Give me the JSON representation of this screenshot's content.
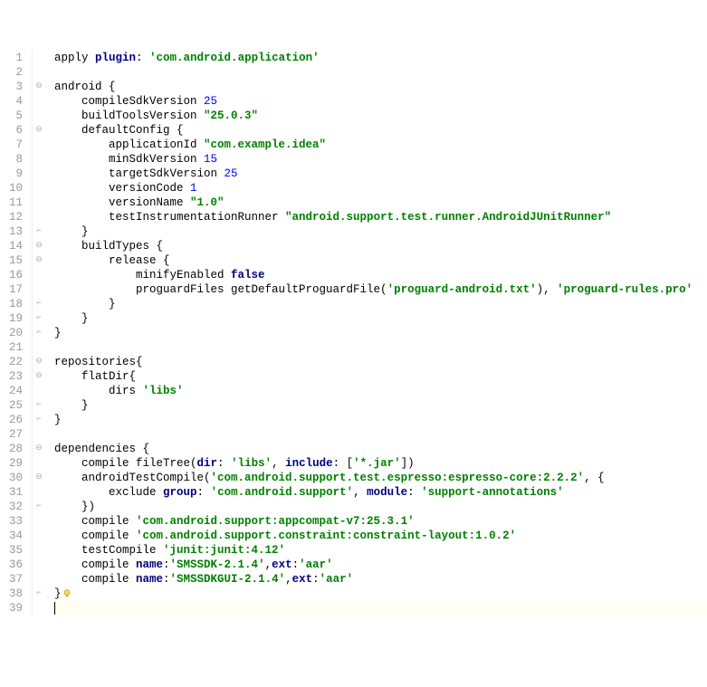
{
  "lines": [
    {
      "n": 1,
      "fold": "",
      "segments": [
        {
          "t": "apply ",
          "c": "plain"
        },
        {
          "t": "plugin",
          "c": "kw"
        },
        {
          "t": ": ",
          "c": "plain"
        },
        {
          "t": "'com.android.application'",
          "c": "str"
        }
      ]
    },
    {
      "n": 2,
      "fold": "",
      "segments": [
        {
          "t": "",
          "c": "plain"
        }
      ]
    },
    {
      "n": 3,
      "fold": "open",
      "segments": [
        {
          "t": "android {",
          "c": "plain"
        }
      ]
    },
    {
      "n": 4,
      "fold": "",
      "segments": [
        {
          "t": "    compileSdkVersion ",
          "c": "plain"
        },
        {
          "t": "25",
          "c": "num"
        }
      ]
    },
    {
      "n": 5,
      "fold": "",
      "segments": [
        {
          "t": "    buildToolsVersion ",
          "c": "plain"
        },
        {
          "t": "\"25.0.3\"",
          "c": "str"
        }
      ]
    },
    {
      "n": 6,
      "fold": "open",
      "segments": [
        {
          "t": "    defaultConfig {",
          "c": "plain"
        }
      ]
    },
    {
      "n": 7,
      "fold": "",
      "segments": [
        {
          "t": "        applicationId ",
          "c": "plain"
        },
        {
          "t": "\"com.example.idea\"",
          "c": "str"
        }
      ]
    },
    {
      "n": 8,
      "fold": "",
      "segments": [
        {
          "t": "        minSdkVersion ",
          "c": "plain"
        },
        {
          "t": "15",
          "c": "num"
        }
      ]
    },
    {
      "n": 9,
      "fold": "",
      "segments": [
        {
          "t": "        targetSdkVersion ",
          "c": "plain"
        },
        {
          "t": "25",
          "c": "num"
        }
      ]
    },
    {
      "n": 10,
      "fold": "",
      "segments": [
        {
          "t": "        versionCode ",
          "c": "plain"
        },
        {
          "t": "1",
          "c": "num"
        }
      ]
    },
    {
      "n": 11,
      "fold": "",
      "segments": [
        {
          "t": "        versionName ",
          "c": "plain"
        },
        {
          "t": "\"1.0\"",
          "c": "str"
        }
      ]
    },
    {
      "n": 12,
      "fold": "",
      "segments": [
        {
          "t": "        testInstrumentationRunner ",
          "c": "plain"
        },
        {
          "t": "\"android.support.test.runner.AndroidJUnitRunner\"",
          "c": "str"
        }
      ]
    },
    {
      "n": 13,
      "fold": "close",
      "segments": [
        {
          "t": "    }",
          "c": "plain"
        }
      ]
    },
    {
      "n": 14,
      "fold": "open",
      "segments": [
        {
          "t": "    buildTypes {",
          "c": "plain"
        }
      ]
    },
    {
      "n": 15,
      "fold": "open",
      "segments": [
        {
          "t": "        release {",
          "c": "plain"
        }
      ]
    },
    {
      "n": 16,
      "fold": "",
      "segments": [
        {
          "t": "            minifyEnabled ",
          "c": "plain"
        },
        {
          "t": "false",
          "c": "bool"
        }
      ]
    },
    {
      "n": 17,
      "fold": "",
      "segments": [
        {
          "t": "            proguardFiles getDefaultProguardFile(",
          "c": "plain"
        },
        {
          "t": "'proguard-android.txt'",
          "c": "str"
        },
        {
          "t": "), ",
          "c": "plain"
        },
        {
          "t": "'proguard-rules.pro'",
          "c": "str"
        }
      ]
    },
    {
      "n": 18,
      "fold": "close",
      "segments": [
        {
          "t": "        }",
          "c": "plain"
        }
      ]
    },
    {
      "n": 19,
      "fold": "close",
      "segments": [
        {
          "t": "    }",
          "c": "plain"
        }
      ]
    },
    {
      "n": 20,
      "fold": "close",
      "segments": [
        {
          "t": "}",
          "c": "plain"
        }
      ]
    },
    {
      "n": 21,
      "fold": "",
      "segments": [
        {
          "t": "",
          "c": "plain"
        }
      ]
    },
    {
      "n": 22,
      "fold": "open",
      "segments": [
        {
          "t": "repositories{",
          "c": "plain"
        }
      ]
    },
    {
      "n": 23,
      "fold": "open",
      "segments": [
        {
          "t": "    flatDir{",
          "c": "plain"
        }
      ]
    },
    {
      "n": 24,
      "fold": "",
      "segments": [
        {
          "t": "        dirs ",
          "c": "plain"
        },
        {
          "t": "'libs'",
          "c": "str"
        }
      ]
    },
    {
      "n": 25,
      "fold": "close",
      "segments": [
        {
          "t": "    }",
          "c": "plain"
        }
      ]
    },
    {
      "n": 26,
      "fold": "close",
      "segments": [
        {
          "t": "}",
          "c": "plain"
        }
      ]
    },
    {
      "n": 27,
      "fold": "",
      "segments": [
        {
          "t": "",
          "c": "plain"
        }
      ]
    },
    {
      "n": 28,
      "fold": "open",
      "segments": [
        {
          "t": "dependencies {",
          "c": "plain"
        }
      ]
    },
    {
      "n": 29,
      "fold": "",
      "segments": [
        {
          "t": "    compile fileTree(",
          "c": "plain"
        },
        {
          "t": "dir",
          "c": "kw"
        },
        {
          "t": ": ",
          "c": "plain"
        },
        {
          "t": "'libs'",
          "c": "str"
        },
        {
          "t": ", ",
          "c": "plain"
        },
        {
          "t": "include",
          "c": "kw"
        },
        {
          "t": ": [",
          "c": "plain"
        },
        {
          "t": "'*.jar'",
          "c": "str"
        },
        {
          "t": "])",
          "c": "plain"
        }
      ]
    },
    {
      "n": 30,
      "fold": "open",
      "segments": [
        {
          "t": "    androidTestCompile(",
          "c": "plain"
        },
        {
          "t": "'com.android.support.test.espresso:espresso-core:2.2.2'",
          "c": "str"
        },
        {
          "t": ", {",
          "c": "plain"
        }
      ]
    },
    {
      "n": 31,
      "fold": "",
      "segments": [
        {
          "t": "        exclude ",
          "c": "plain"
        },
        {
          "t": "group",
          "c": "kw"
        },
        {
          "t": ": ",
          "c": "plain"
        },
        {
          "t": "'com.android.support'",
          "c": "str"
        },
        {
          "t": ", ",
          "c": "plain"
        },
        {
          "t": "module",
          "c": "kw"
        },
        {
          "t": ": ",
          "c": "plain"
        },
        {
          "t": "'support-annotations'",
          "c": "str"
        }
      ]
    },
    {
      "n": 32,
      "fold": "close",
      "segments": [
        {
          "t": "    })",
          "c": "plain"
        }
      ]
    },
    {
      "n": 33,
      "fold": "",
      "segments": [
        {
          "t": "    compile ",
          "c": "plain"
        },
        {
          "t": "'com.android.support:appcompat-v7:25.3.1'",
          "c": "str"
        }
      ]
    },
    {
      "n": 34,
      "fold": "",
      "segments": [
        {
          "t": "    compile ",
          "c": "plain"
        },
        {
          "t": "'com.android.support.constraint:constraint-layout:1.0.2'",
          "c": "str"
        }
      ]
    },
    {
      "n": 35,
      "fold": "",
      "segments": [
        {
          "t": "    testCompile ",
          "c": "plain"
        },
        {
          "t": "'junit:junit:4.12'",
          "c": "str"
        }
      ]
    },
    {
      "n": 36,
      "fold": "",
      "segments": [
        {
          "t": "    compile ",
          "c": "plain"
        },
        {
          "t": "name",
          "c": "kw"
        },
        {
          "t": ":",
          "c": "plain"
        },
        {
          "t": "'SMSSDK-2.1.4'",
          "c": "str"
        },
        {
          "t": ",",
          "c": "plain"
        },
        {
          "t": "ext",
          "c": "kw"
        },
        {
          "t": ":",
          "c": "plain"
        },
        {
          "t": "'aar'",
          "c": "str"
        }
      ]
    },
    {
      "n": 37,
      "fold": "",
      "segments": [
        {
          "t": "    compile ",
          "c": "plain"
        },
        {
          "t": "name",
          "c": "kw"
        },
        {
          "t": ":",
          "c": "plain"
        },
        {
          "t": "'SMSSDKGUI-2.1.4'",
          "c": "str"
        },
        {
          "t": ",",
          "c": "plain"
        },
        {
          "t": "ext",
          "c": "kw"
        },
        {
          "t": ":",
          "c": "plain"
        },
        {
          "t": "'aar'",
          "c": "str"
        }
      ]
    },
    {
      "n": 38,
      "fold": "close",
      "bulb": true,
      "segments": [
        {
          "t": "}",
          "c": "plain"
        }
      ]
    },
    {
      "n": 39,
      "fold": "",
      "caret": true,
      "current": true,
      "segments": [
        {
          "t": "",
          "c": "plain"
        }
      ]
    }
  ],
  "foldMarks": {
    "open": "⊖",
    "close": "⌐"
  }
}
